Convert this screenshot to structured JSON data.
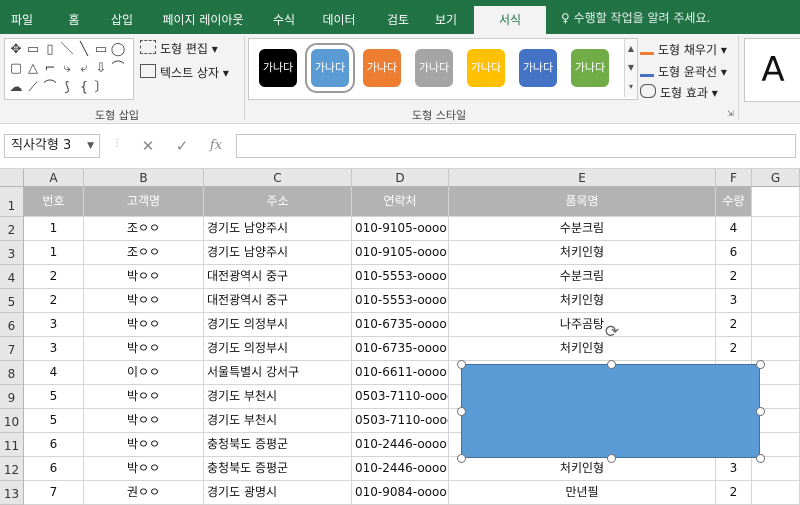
{
  "ribbon_tabs": [
    "파일",
    "홈",
    "삽입",
    "페이지 레이아웃",
    "수식",
    "데이터",
    "검토",
    "보기",
    "서식"
  ],
  "active_tab": "서식",
  "tell_me": "수행할 작업을 알려 주세요.",
  "insert_shapes": {
    "edit_shape": "도형 편집",
    "text_box": "텍스트 상자",
    "label": "도형 삽입"
  },
  "shape_styles": {
    "label": "도형 스타일",
    "swatch_text": "가나다",
    "swatches": [
      {
        "color": "#000000",
        "selected": false
      },
      {
        "color": "#5b9bd5",
        "selected": true
      },
      {
        "color": "#ed7d31",
        "selected": false
      },
      {
        "color": "#a5a5a5",
        "selected": false
      },
      {
        "color": "#ffc000",
        "selected": false
      },
      {
        "color": "#4472c4",
        "selected": false
      },
      {
        "color": "#70ad47",
        "selected": false
      }
    ],
    "fill": "도형 채우기",
    "outline": "도형 윤곽선",
    "effects": "도형 효과"
  },
  "wordart_letter": "A",
  "name_box": "직사각형 3",
  "fx_label": "fx",
  "columns": [
    "A",
    "B",
    "C",
    "D",
    "E",
    "F",
    "G"
  ],
  "row_numbers": [
    "1",
    "2",
    "3",
    "4",
    "5",
    "6",
    "7",
    "8",
    "9",
    "10",
    "11",
    "12",
    "13"
  ],
  "headers": [
    "번호",
    "고객명",
    "주소",
    "연락처",
    "품목명",
    "수량"
  ],
  "rows": [
    [
      "1",
      "조ㅇㅇ",
      "경기도 남양주시",
      "010-9105-oooo",
      "수분크림",
      "4"
    ],
    [
      "1",
      "조ㅇㅇ",
      "경기도 남양주시",
      "010-9105-oooo",
      "처키인형",
      "6"
    ],
    [
      "2",
      "박ㅇㅇ",
      "대전광역시 중구",
      "010-5553-oooo",
      "수분크림",
      "2"
    ],
    [
      "2",
      "박ㅇㅇ",
      "대전광역시 중구",
      "010-5553-oooo",
      "처키인형",
      "3"
    ],
    [
      "3",
      "박ㅇㅇ",
      "경기도 의정부시",
      "010-6735-oooo",
      "나주곰탕",
      "2"
    ],
    [
      "3",
      "박ㅇㅇ",
      "경기도 의정부시",
      "010-6735-oooo",
      "처키인형",
      "2"
    ],
    [
      "4",
      "이ㅇㅇ",
      "서울특별시 강서구",
      "010-6611-oooo",
      "",
      ""
    ],
    [
      "5",
      "박ㅇㅇ",
      "경기도 부천시",
      "0503-7110-oooo",
      "",
      ""
    ],
    [
      "5",
      "박ㅇㅇ",
      "경기도 부천시",
      "0503-7110-oooo",
      "",
      ""
    ],
    [
      "6",
      "박ㅇㅇ",
      "충청북도 증평군",
      "010-2446-oooo",
      "",
      ""
    ],
    [
      "6",
      "박ㅇㅇ",
      "충청북도 증평군",
      "010-2446-oooo",
      "처키인형",
      "3"
    ],
    [
      "7",
      "권ㅇㅇ",
      "경기도 광명시",
      "010-9084-oooo",
      "만년필",
      "2"
    ]
  ],
  "shape_color": "#5b9bd5"
}
